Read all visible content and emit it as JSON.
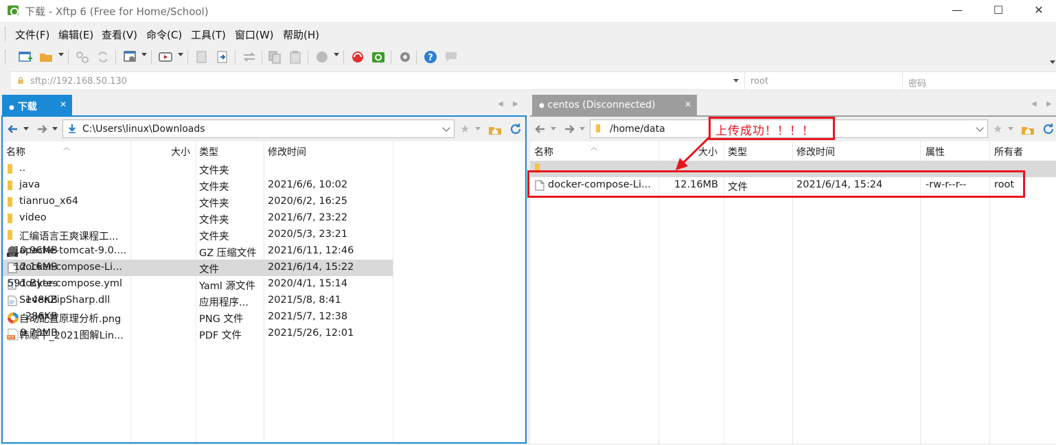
{
  "window": {
    "title": "下载 - Xftp 6 (Free for Home/School)",
    "minimize": "—",
    "maximize": "☐",
    "close": "✕"
  },
  "menu": [
    "文件(F)",
    "编辑(E)",
    "查看(V)",
    "命令(C)",
    "工具(T)",
    "窗口(W)",
    "帮助(H)"
  ],
  "address": {
    "url": "sftp://192.168.50.130",
    "user": "root",
    "password_placeholder": "密码"
  },
  "left": {
    "tab_label": "下载",
    "path": "C:\\Users\\linux\\Downloads",
    "columns": [
      "名称",
      "大小",
      "类型",
      "修改时间"
    ],
    "files": [
      {
        "name": "..",
        "size": "",
        "type": "文件夹",
        "modified": "",
        "icon": "folder-icon"
      },
      {
        "name": "java",
        "size": "",
        "type": "文件夹",
        "modified": "2021/6/6, 10:02",
        "icon": "folder-icon"
      },
      {
        "name": "tianruo_x64",
        "size": "",
        "type": "文件夹",
        "modified": "2020/6/2, 16:25",
        "icon": "folder-icon"
      },
      {
        "name": "video",
        "size": "",
        "type": "文件夹",
        "modified": "2021/6/7, 23:22",
        "icon": "folder-icon"
      },
      {
        "name": "汇编语言王爽课程工...",
        "size": "",
        "type": "文件夹",
        "modified": "2020/5/3, 23:21",
        "icon": "folder-icon"
      },
      {
        "name": "apache-tomcat-9.0....",
        "size": "10.96MB",
        "type": "GZ 压缩文件",
        "modified": "2021/6/11, 12:46",
        "icon": "gz-archive-icon"
      },
      {
        "name": "docker-compose-Li...",
        "size": "12.16MB",
        "type": "文件",
        "modified": "2021/6/14, 15:22",
        "icon": "file-icon",
        "selected": true
      },
      {
        "name": "docker-compose.yml",
        "size": "591 Bytes",
        "type": "Yaml 源文件",
        "modified": "2020/4/1, 15:14",
        "icon": "yaml-file-icon"
      },
      {
        "name": "SevenZipSharp.dll",
        "size": "148KB",
        "type": "应用程序...",
        "modified": "2021/5/8, 8:41",
        "icon": "dll-file-icon"
      },
      {
        "name": "自动配置原理分析.png",
        "size": "286KB",
        "type": "PNG 文件",
        "modified": "2021/5/7, 12:38",
        "icon": "png-file-icon"
      },
      {
        "name": "韩顺平_2021图解Lin...",
        "size": "9.73MB",
        "type": "PDF 文件",
        "modified": "2021/5/26, 12:01",
        "icon": "pdf-file-icon"
      }
    ]
  },
  "right": {
    "tab_label": "centos (Disconnected)",
    "path": "/home/data",
    "columns": [
      "名称",
      "大小",
      "类型",
      "修改时间",
      "属性",
      "所有者"
    ],
    "files": [
      {
        "name": "docker-compose-Li...",
        "size": "12.16MB",
        "type": "文件",
        "modified": "2021/6/14, 15:24",
        "attrs": "-rw-r--r--",
        "owner": "root"
      }
    ]
  },
  "annotation": {
    "text": "上传成功！！！！",
    "color": "#e8141d"
  },
  "colors": {
    "active_tab": "#1a89d6",
    "inactive_tab": "#9d9d9d",
    "selected_row": "#d9d9d9",
    "folder": "#f5c242"
  }
}
